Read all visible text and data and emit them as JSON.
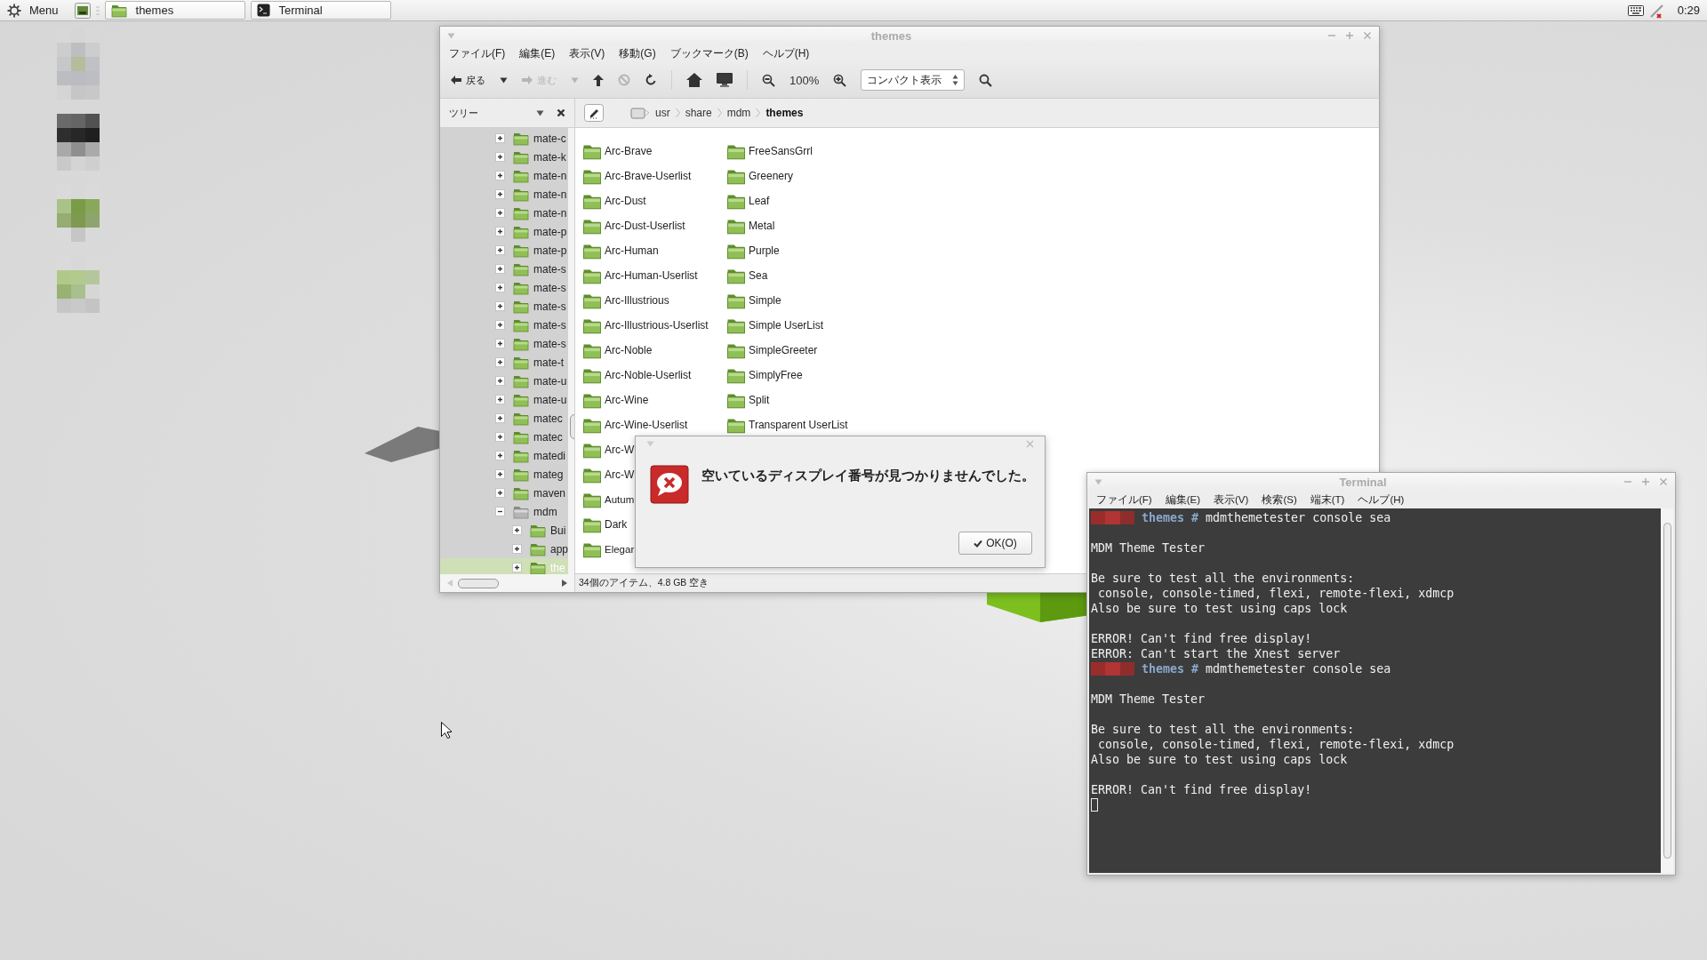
{
  "taskbar": {
    "menu_label": "Menu",
    "tasks": [
      {
        "label": "themes",
        "kind": "folder",
        "selected": false
      },
      {
        "label": "Terminal",
        "kind": "terminal",
        "selected": false
      }
    ],
    "clock": "0:29"
  },
  "desktop": {
    "icons": [
      {
        "kind": "gray"
      },
      {
        "kind": "dark"
      },
      {
        "kind": "green"
      },
      {
        "kind": "light-green"
      }
    ]
  },
  "file_manager": {
    "title": "themes",
    "menus": [
      "ファイル(F)",
      "編集(E)",
      "表示(V)",
      "移動(G)",
      "ブックマーク(B)",
      "ヘルプ(H)"
    ],
    "toolbar": [
      {
        "kind": "back",
        "label": "戻る",
        "disabled": false
      },
      {
        "kind": "back-menu",
        "disabled": false
      },
      {
        "kind": "forward",
        "label": "進む",
        "disabled": true
      },
      {
        "kind": "forward-menu",
        "disabled": true
      },
      {
        "kind": "up",
        "disabled": false
      },
      {
        "kind": "stop",
        "disabled": true
      },
      {
        "kind": "reload",
        "disabled": false
      },
      {
        "kind": "separator"
      },
      {
        "kind": "home",
        "disabled": false
      },
      {
        "kind": "computer",
        "disabled": false
      },
      {
        "kind": "separator"
      },
      {
        "kind": "zoom-out",
        "disabled": false
      },
      {
        "kind": "zoom-level",
        "label": "100%"
      },
      {
        "kind": "zoom-in",
        "disabled": false
      },
      {
        "kind": "view-select",
        "label": "コンパクト表示"
      },
      {
        "kind": "search",
        "disabled": false
      }
    ],
    "sidebar": {
      "title": "ツリー",
      "tree": [
        {
          "label": "mate-c",
          "expanded": false,
          "selected": false
        },
        {
          "label": "mate-k",
          "expanded": false,
          "selected": false
        },
        {
          "label": "mate-n",
          "expanded": false,
          "selected": false
        },
        {
          "label": "mate-n",
          "expanded": false,
          "selected": false
        },
        {
          "label": "mate-n",
          "expanded": false,
          "selected": false
        },
        {
          "label": "mate-p",
          "expanded": false,
          "selected": false
        },
        {
          "label": "mate-p",
          "expanded": false,
          "selected": false
        },
        {
          "label": "mate-s",
          "expanded": false,
          "selected": false
        },
        {
          "label": "mate-s",
          "expanded": false,
          "selected": false
        },
        {
          "label": "mate-s",
          "expanded": false,
          "selected": false
        },
        {
          "label": "mate-s",
          "expanded": false,
          "selected": false
        },
        {
          "label": "mate-s",
          "expanded": false,
          "selected": false
        },
        {
          "label": "mate-t",
          "expanded": false,
          "selected": false
        },
        {
          "label": "mate-u",
          "expanded": false,
          "selected": false
        },
        {
          "label": "mate-u",
          "expanded": false,
          "selected": false
        },
        {
          "label": "matec",
          "expanded": false,
          "selected": false
        },
        {
          "label": "matec",
          "expanded": false,
          "selected": false
        },
        {
          "label": "matedi",
          "expanded": false,
          "selected": false
        },
        {
          "label": "mateg",
          "expanded": false,
          "selected": false
        },
        {
          "label": "maven",
          "expanded": false,
          "selected": false
        },
        {
          "label": "mdm",
          "expanded": true,
          "selected": false,
          "children": [
            {
              "label": "Bui",
              "expanded": false,
              "selected": false
            },
            {
              "label": "app",
              "expanded": false,
              "selected": false
            },
            {
              "label": "the",
              "expanded": false,
              "selected": true
            }
          ]
        }
      ]
    },
    "path": [
      {
        "label": "usr",
        "selected": false
      },
      {
        "label": "share",
        "selected": false
      },
      {
        "label": "mdm",
        "selected": false
      },
      {
        "label": "themes",
        "selected": true
      }
    ],
    "files": [
      "Arc-Brave",
      "Arc-Brave-Userlist",
      "Arc-Dust",
      "Arc-Dust-Userlist",
      "Arc-Human",
      "Arc-Human-Userlist",
      "Arc-Illustrious",
      "Arc-Illustrious-Userlist",
      "Arc-Noble",
      "Arc-Noble-Userlist",
      "Arc-Wine",
      "Arc-Wine-Userlist",
      "Arc-W",
      "Arc-W",
      "Autum",
      "Dark",
      "Elegar",
      "FreeSansGrrl",
      "Greenery",
      "Leaf",
      "Metal",
      "Purple",
      "Sea",
      "Simple",
      "Simple UserList",
      "SimpleGreeter",
      "SimplyFree",
      "Split",
      "Transparent UserList"
    ],
    "status": "34個のアイテム、4.8 GB 空き"
  },
  "dialog": {
    "message": "空いているディスプレイ番号が見つかりませんでした。",
    "button": "OK(O)"
  },
  "terminal": {
    "title": "Terminal",
    "menus": [
      "ファイル(F)",
      "編集(E)",
      "表示(V)",
      "検索(S)",
      "端末(T)",
      "ヘルプ(H)"
    ],
    "lines": [
      {
        "kind": "prompt",
        "dir": "themes",
        "sign": "#",
        "command": "mdmthemetester console sea"
      },
      {
        "kind": "blank"
      },
      {
        "kind": "output",
        "text": "MDM Theme Tester"
      },
      {
        "kind": "blank"
      },
      {
        "kind": "output",
        "text": "Be sure to test all the environments:"
      },
      {
        "kind": "output",
        "text": " console, console-timed, flexi, remote-flexi, xdmcp"
      },
      {
        "kind": "output",
        "text": "Also be sure to test using caps lock"
      },
      {
        "kind": "blank"
      },
      {
        "kind": "output",
        "text": "ERROR! Can't find free display!"
      },
      {
        "kind": "output",
        "text": "ERROR: Can't start the Xnest server"
      },
      {
        "kind": "prompt",
        "dir": "themes",
        "sign": "#",
        "command": "mdmthemetester console sea"
      },
      {
        "kind": "blank"
      },
      {
        "kind": "output",
        "text": "MDM Theme Tester"
      },
      {
        "kind": "blank"
      },
      {
        "kind": "output",
        "text": "Be sure to test all the environments:"
      },
      {
        "kind": "output",
        "text": " console, console-timed, flexi, remote-flexi, xdmcp"
      },
      {
        "kind": "output",
        "text": "Also be sure to test using caps lock"
      },
      {
        "kind": "blank"
      },
      {
        "kind": "output",
        "text": "ERROR! Can't find free display!"
      },
      {
        "kind": "cursor"
      }
    ]
  }
}
